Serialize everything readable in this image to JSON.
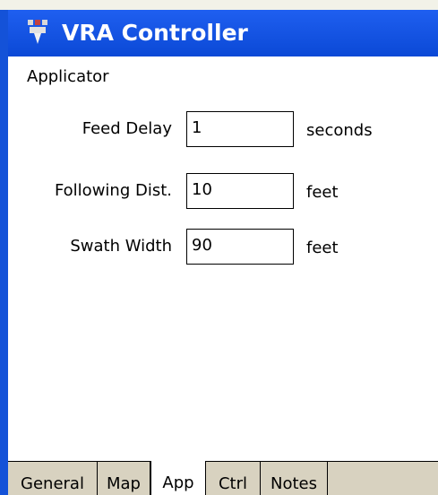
{
  "title_bar": {
    "title": "VRA Controller",
    "icon": "app-icon"
  },
  "section": {
    "label": "Applicator"
  },
  "fields": {
    "feed_delay": {
      "label": "Feed Delay",
      "value": "1",
      "unit": "seconds"
    },
    "following_distance": {
      "label": "Following Dist.",
      "value": "10",
      "unit": "feet"
    },
    "swath_width": {
      "label": "Swath Width",
      "value": "90",
      "unit": "feet"
    }
  },
  "tabs": [
    {
      "label": "General",
      "active": false
    },
    {
      "label": "Map",
      "active": false
    },
    {
      "label": "App",
      "active": true
    },
    {
      "label": "Ctrl",
      "active": false
    },
    {
      "label": "Notes",
      "active": false
    }
  ],
  "colors": {
    "title_bar": "#0b49d6",
    "tab_strip": "#d8d2c0"
  }
}
